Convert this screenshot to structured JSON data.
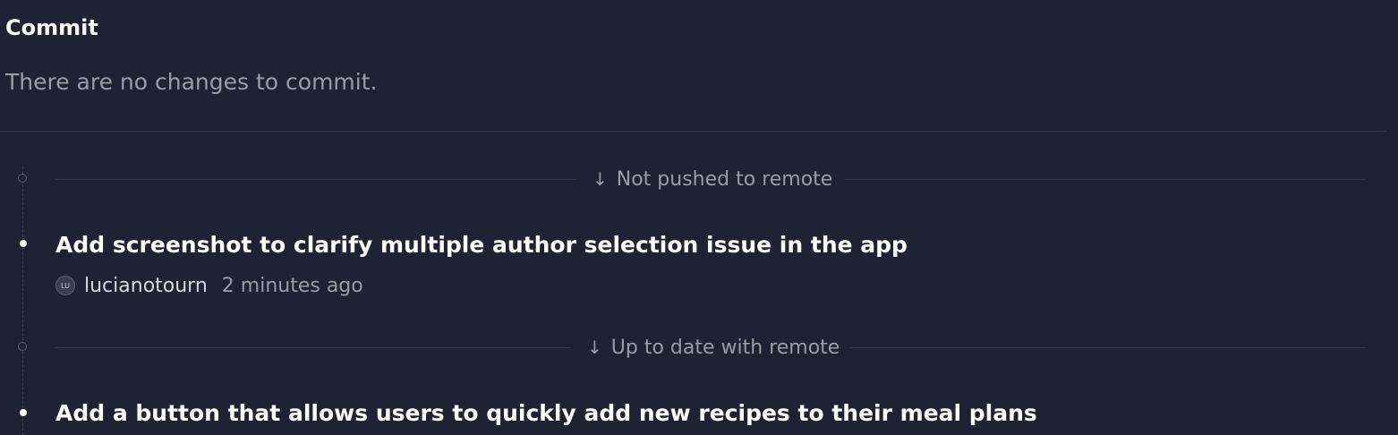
{
  "commit_panel": {
    "title": "Commit",
    "empty_message": "There are no changes to commit."
  },
  "history": {
    "sections": [
      {
        "label": "Not pushed to remote",
        "icon": "arrow-down-icon",
        "commits": [
          {
            "message": "Add screenshot to clarify multiple author selection issue in the app",
            "author": "lucianotourn",
            "author_initials": "LU",
            "time": "2 minutes ago"
          }
        ]
      },
      {
        "label": "Up to date with remote",
        "icon": "arrow-down-icon",
        "commits": [
          {
            "message": "Add a button that allows users to quickly add new recipes to their meal plans"
          }
        ]
      }
    ]
  },
  "colors": {
    "background": "#1f2233",
    "divider": "#353a4a",
    "primary_text": "#ffffff",
    "secondary_text": "#9a9ca6"
  }
}
